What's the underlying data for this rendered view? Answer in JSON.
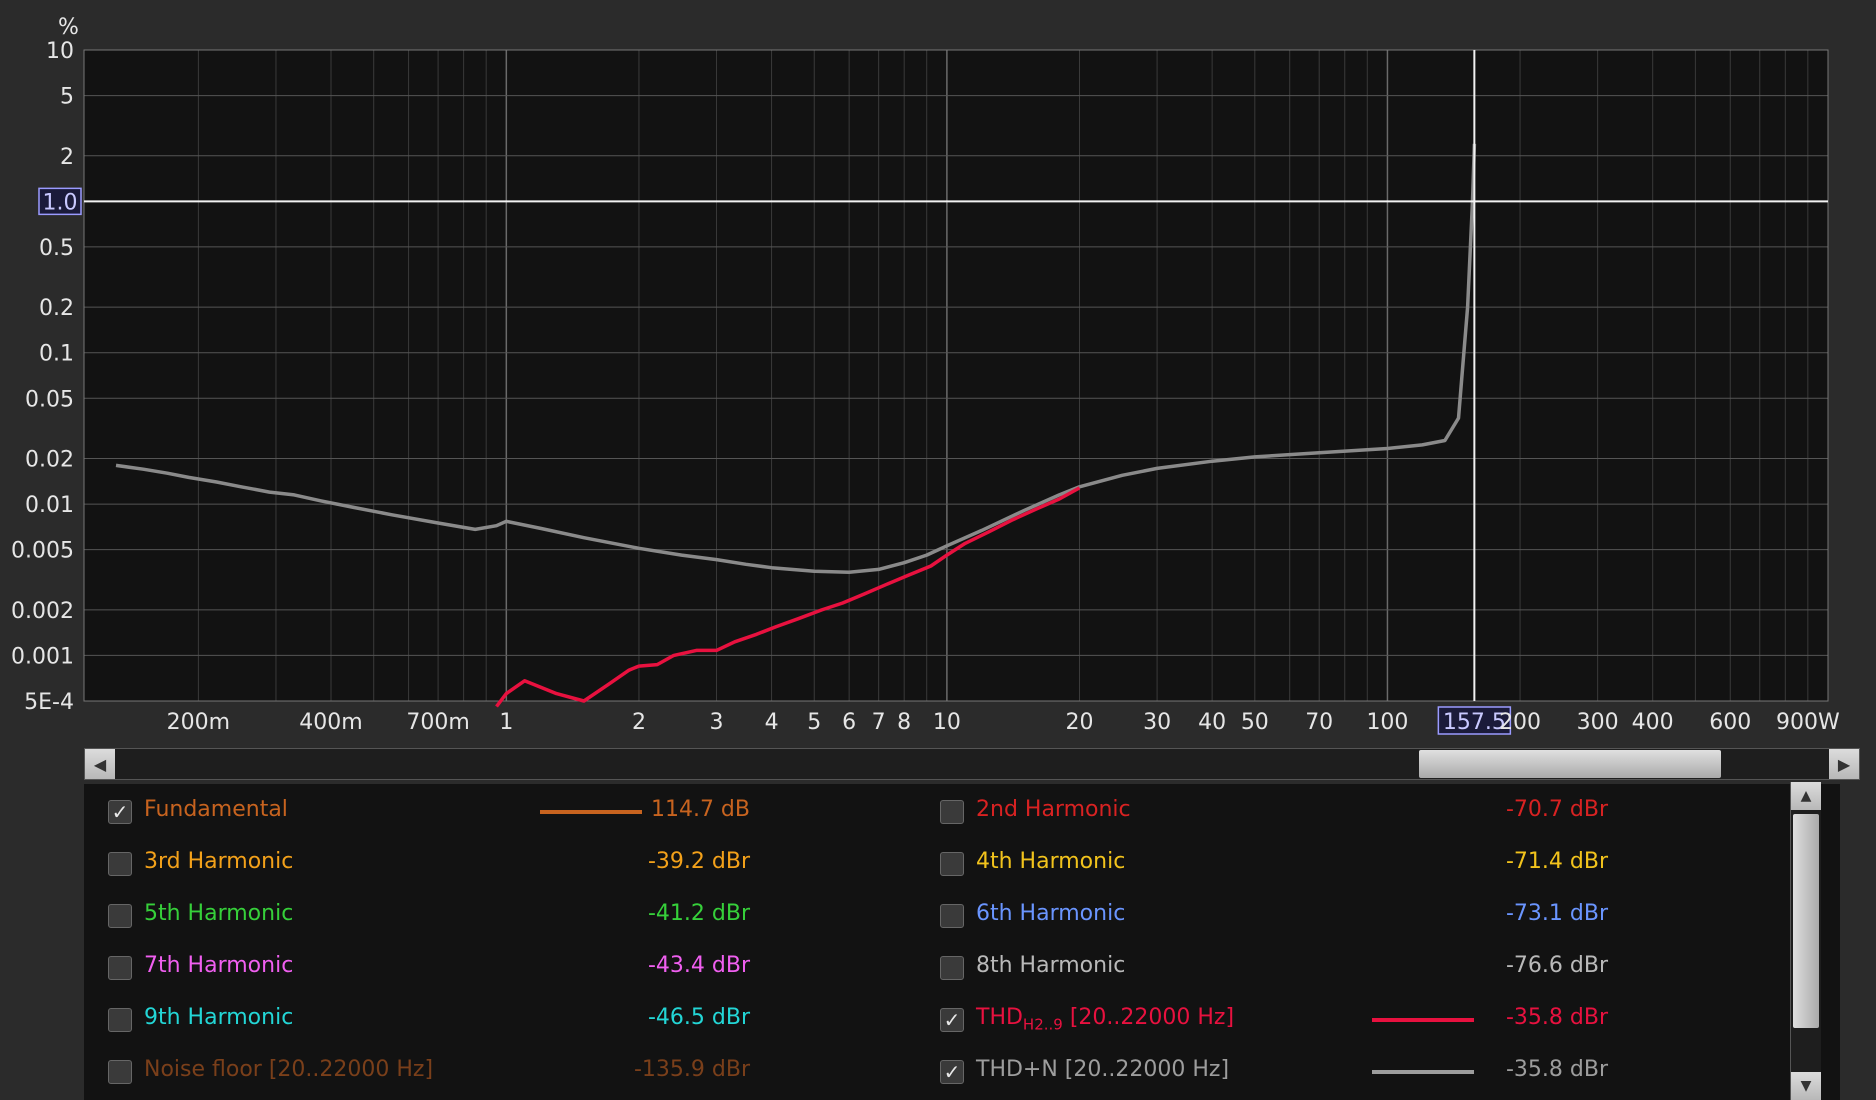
{
  "chart_data": {
    "type": "line",
    "x_scale": "log",
    "y_scale": "log",
    "y_unit_label": "%",
    "xlim": [
      0.11,
      1000
    ],
    "ylim": [
      0.0005,
      10
    ],
    "y_ticks": [
      {
        "v": 10,
        "label": "10"
      },
      {
        "v": 5,
        "label": "5"
      },
      {
        "v": 2,
        "label": "2"
      },
      {
        "v": 0.5,
        "label": "0.5"
      },
      {
        "v": 0.2,
        "label": "0.2"
      },
      {
        "v": 0.1,
        "label": "0.1"
      },
      {
        "v": 0.05,
        "label": "0.05"
      },
      {
        "v": 0.02,
        "label": "0.02"
      },
      {
        "v": 0.01,
        "label": "0.01"
      },
      {
        "v": 0.005,
        "label": "0.005"
      },
      {
        "v": 0.002,
        "label": "0.002"
      },
      {
        "v": 0.001,
        "label": "0.001"
      },
      {
        "v": 0.0005,
        "label": "5E-4"
      }
    ],
    "x_ticks": [
      {
        "v": 0.2,
        "label": "200m"
      },
      {
        "v": 0.4,
        "label": "400m"
      },
      {
        "v": 0.7,
        "label": "700m"
      },
      {
        "v": 1,
        "label": "1"
      },
      {
        "v": 2,
        "label": "2"
      },
      {
        "v": 3,
        "label": "3"
      },
      {
        "v": 4,
        "label": "4"
      },
      {
        "v": 5,
        "label": "5"
      },
      {
        "v": 6,
        "label": "6"
      },
      {
        "v": 7,
        "label": "7"
      },
      {
        "v": 8,
        "label": "8"
      },
      {
        "v": 10,
        "label": "10"
      },
      {
        "v": 20,
        "label": "20"
      },
      {
        "v": 30,
        "label": "30"
      },
      {
        "v": 40,
        "label": "40"
      },
      {
        "v": 50,
        "label": "50"
      },
      {
        "v": 70,
        "label": "70"
      },
      {
        "v": 100,
        "label": "100"
      },
      {
        "v": 200,
        "label": "200"
      },
      {
        "v": 300,
        "label": "300"
      },
      {
        "v": 400,
        "label": "400"
      },
      {
        "v": 600,
        "label": "600"
      },
      {
        "v": 900,
        "label": "900W"
      }
    ],
    "y_marker": {
      "v": 1.0,
      "label": "1.0"
    },
    "x_marker": {
      "v": 157.5,
      "label": "157.5"
    },
    "grid": true,
    "series": [
      {
        "name": "THD+N [20..22000 Hz]",
        "color": "#8a8a8a",
        "x": [
          0.13,
          0.15,
          0.17,
          0.19,
          0.22,
          0.25,
          0.29,
          0.33,
          0.38,
          0.45,
          0.55,
          0.7,
          0.85,
          0.95,
          1.0,
          1.2,
          1.5,
          2.0,
          2.5,
          3.0,
          3.5,
          4.0,
          5.0,
          6.0,
          7.0,
          8.0,
          9.0,
          10,
          12,
          15,
          18,
          20,
          25,
          30,
          40,
          50,
          70,
          100,
          120,
          135,
          145,
          152,
          156,
          157.5
        ],
        "y": [
          0.018,
          0.017,
          0.016,
          0.015,
          0.014,
          0.013,
          0.012,
          0.0115,
          0.0105,
          0.0095,
          0.0085,
          0.0075,
          0.0068,
          0.0072,
          0.0077,
          0.0069,
          0.006,
          0.0051,
          0.0046,
          0.0043,
          0.004,
          0.0038,
          0.0036,
          0.00355,
          0.0037,
          0.0041,
          0.0046,
          0.0053,
          0.0067,
          0.0091,
          0.0115,
          0.013,
          0.0155,
          0.0172,
          0.0192,
          0.0205,
          0.0218,
          0.0233,
          0.0246,
          0.0263,
          0.037,
          0.2,
          1.0,
          2.4
        ]
      },
      {
        "name": "THD H2..9 [20..22000 Hz]",
        "color": "#e8113f",
        "x": [
          0.95,
          1.0,
          1.1,
          1.3,
          1.5,
          1.7,
          1.9,
          2.0,
          2.2,
          2.4,
          2.7,
          3.0,
          3.3,
          3.7,
          4.1,
          4.6,
          5.2,
          5.8,
          6.5,
          7.3,
          8.2,
          9.2,
          10,
          11,
          12.5,
          14,
          16,
          18,
          20
        ],
        "y": [
          0.00046,
          0.00056,
          0.00068,
          0.00056,
          0.0005,
          0.00064,
          0.0008,
          0.00085,
          0.00087,
          0.001,
          0.00108,
          0.00108,
          0.00123,
          0.00138,
          0.00155,
          0.00175,
          0.002,
          0.00222,
          0.00255,
          0.00295,
          0.0034,
          0.0039,
          0.0046,
          0.0055,
          0.0066,
          0.0078,
          0.0093,
          0.0108,
          0.0128
        ]
      }
    ]
  },
  "legend": {
    "items": [
      {
        "label": "Fundamental",
        "value": "114.7 dB",
        "checked": true,
        "color": "#c7631f",
        "line": true
      },
      {
        "label": "2nd Harmonic",
        "value": "-70.7 dBr",
        "checked": false,
        "color": "#d82222",
        "line": false
      },
      {
        "label": "3rd Harmonic",
        "value": "-39.2 dBr",
        "checked": false,
        "color": "#f3a11a",
        "line": false
      },
      {
        "label": "4th Harmonic",
        "value": "-71.4 dBr",
        "checked": false,
        "color": "#f2c31c",
        "line": false
      },
      {
        "label": "5th Harmonic",
        "value": "-41.2 dBr",
        "checked": false,
        "color": "#36d03a",
        "line": false
      },
      {
        "label": "6th Harmonic",
        "value": "-73.1 dBr",
        "checked": false,
        "color": "#6a95ff",
        "line": false
      },
      {
        "label": "7th Harmonic",
        "value": "-43.4 dBr",
        "checked": false,
        "color": "#f05ff0",
        "line": false
      },
      {
        "label": "8th Harmonic",
        "value": "-76.6 dBr",
        "checked": false,
        "color": "#b9b9b9",
        "line": false
      },
      {
        "label": "9th Harmonic",
        "value": "-46.5 dBr",
        "checked": false,
        "color": "#23d6d6",
        "line": false
      },
      {
        "label": "THD",
        "sub": "H2..9",
        "label_suffix": " [20..22000 Hz]",
        "value": "-35.8 dBr",
        "checked": true,
        "color": "#e8113f",
        "line": true
      },
      {
        "label": "Noise floor [20..22000 Hz]",
        "value": "-135.9 dBr",
        "checked": false,
        "color": "#7a3f1a",
        "line": false
      },
      {
        "label": "THD+N [20..22000 Hz]",
        "value": "-35.8 dBr",
        "checked": true,
        "color": "#9d9d9d",
        "line": true
      }
    ]
  },
  "controls": {
    "scroll_left_icon": "◀",
    "scroll_right_icon": "▶",
    "scroll_up_icon": "▲",
    "scroll_down_icon": "▼",
    "check_glyph": "✓"
  }
}
